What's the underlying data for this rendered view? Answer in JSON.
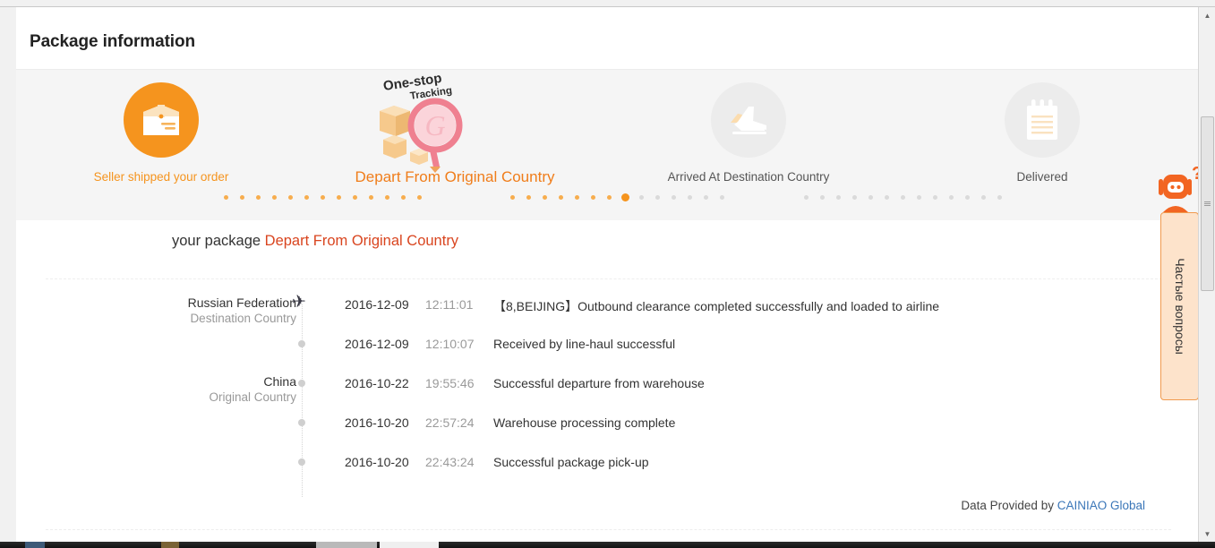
{
  "card": {
    "title": "Package information"
  },
  "progress": {
    "accent_color": "#f5941e",
    "inactive_color": "#ececec",
    "steps": [
      {
        "label": "Seller shipped your order",
        "icon": "package-box-icon",
        "state": "active"
      },
      {
        "label": "Depart From Original Country",
        "icon": "one-stop-tracking-magnifier-icon",
        "state": "current",
        "badge_line1": "One-stop",
        "badge_line2": "Tracking",
        "badge_letter": "G"
      },
      {
        "label": "Arrived At Destination Country",
        "icon": "airplane-landing-icon",
        "state": "inactive"
      },
      {
        "label": "Delivered",
        "icon": "notepad-icon",
        "state": "inactive"
      }
    ]
  },
  "status": {
    "prefix": "your package ",
    "highlight": "Depart From Original Country",
    "highlight_color": "#d9451f"
  },
  "timeline": {
    "rows": [
      {
        "country": "Russian Federation",
        "country_sub": "Destination Country",
        "marker": "airplane-icon",
        "date": "2016-12-09",
        "time": "12:11:01",
        "desc": "【8,BEIJING】Outbound clearance completed successfully and loaded to airline"
      },
      {
        "country": "",
        "country_sub": "",
        "marker": "bullet-icon",
        "date": "2016-12-09",
        "time": "12:10:07",
        "desc": "Received by line-haul successful"
      },
      {
        "country": "China",
        "country_sub": "Original Country",
        "marker": "bullet-icon",
        "date": "2016-10-22",
        "time": "19:55:46",
        "desc": "Successful departure from warehouse"
      },
      {
        "country": "",
        "country_sub": "",
        "marker": "bullet-icon",
        "date": "2016-10-20",
        "time": "22:57:24",
        "desc": "Warehouse processing complete"
      },
      {
        "country": "",
        "country_sub": "",
        "marker": "bullet-icon",
        "date": "2016-10-20",
        "time": "22:43:24",
        "desc": "Successful package pick-up"
      }
    ]
  },
  "provider": {
    "prefix": "Data Provided by ",
    "link_label": "CAINIAO Global",
    "link_color": "#3a76b8"
  },
  "faq_widget": {
    "label": "Частые вопросы",
    "icon": "robot-question-icon",
    "panel_color": "#fde3cb",
    "border_color": "#f09a4e"
  },
  "scrollbar": {
    "up_arrow": "▲",
    "down_arrow": "▼"
  }
}
